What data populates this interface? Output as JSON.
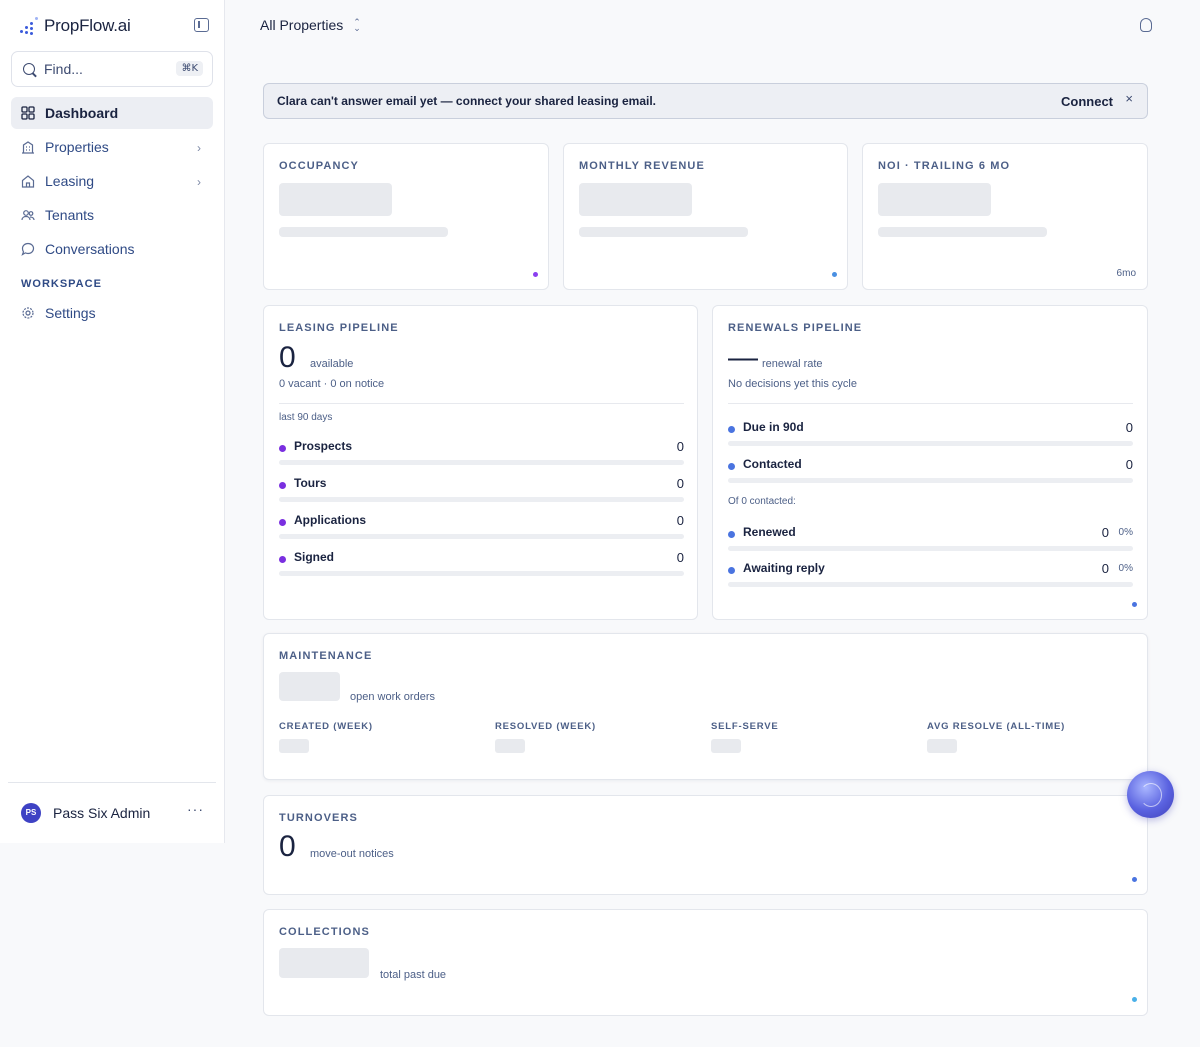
{
  "brand": {
    "name": "PropFlow.ai",
    "accent": "#3b5bdb"
  },
  "search": {
    "placeholder": "Find...",
    "shortcut": "⌘K"
  },
  "sidebar": {
    "items": [
      {
        "label": "Dashboard",
        "icon": "grid-icon",
        "active": true
      },
      {
        "label": "Properties",
        "icon": "building-icon",
        "has_children": true
      },
      {
        "label": "Leasing",
        "icon": "house-icon",
        "has_children": true
      },
      {
        "label": "Tenants",
        "icon": "people-icon"
      },
      {
        "label": "Conversations",
        "icon": "chat-bubble-icon"
      }
    ],
    "section_label": "WORKSPACE",
    "workspace_items": [
      {
        "label": "Settings",
        "icon": "gear-icon"
      }
    ],
    "user": {
      "initials": "PS",
      "name": "Pass Six Admin",
      "more": "···"
    }
  },
  "topbar": {
    "property_select": "All Properties"
  },
  "banner": {
    "text": "Clara can't answer email yet — connect your shared leasing email.",
    "action": "Connect",
    "close": "×"
  },
  "kpis": {
    "occupancy": {
      "title": "OCCUPANCY",
      "dot_color": "#8b3ff0"
    },
    "monthly_revenue": {
      "title": "MONTHLY REVENUE",
      "dot_color": "#4a90e2"
    },
    "noi": {
      "title": "NOI · TRAILING 6 MO",
      "period": "6mo"
    }
  },
  "leasing": {
    "title": "LEASING PIPELINE",
    "count": "0",
    "count_label": "available",
    "sub": "0 vacant · 0 on notice",
    "window": "last 90 days",
    "bullet_color": "#7a2fe0",
    "stages": [
      {
        "label": "Prospects",
        "value": "0"
      },
      {
        "label": "Tours",
        "value": "0"
      },
      {
        "label": "Applications",
        "value": "0"
      },
      {
        "label": "Signed",
        "value": "0"
      }
    ]
  },
  "renewals": {
    "title": "RENEWALS PIPELINE",
    "rate": "—",
    "rate_label": "renewal rate",
    "sub": "No decisions yet this cycle",
    "bullet_color": "#4a74e0",
    "stages": [
      {
        "label": "Due in 90d",
        "value": "0"
      },
      {
        "label": "Contacted",
        "value": "0"
      }
    ],
    "contacted_label": "Of 0 contacted:",
    "outcomes": [
      {
        "label": "Renewed",
        "value": "0",
        "pct": "0%"
      },
      {
        "label": "Awaiting reply",
        "value": "0",
        "pct": "0%"
      }
    ]
  },
  "maintenance": {
    "title": "MAINTENANCE",
    "caption": "open work orders",
    "columns": [
      "CREATED (WEEK)",
      "RESOLVED (WEEK)",
      "SELF-SERVE",
      "AVG RESOLVE (ALL-TIME)"
    ]
  },
  "turnovers": {
    "title": "TURNOVERS",
    "count": "0",
    "caption": "move-out notices"
  },
  "collections": {
    "title": "COLLECTIONS",
    "caption": "total past due"
  }
}
